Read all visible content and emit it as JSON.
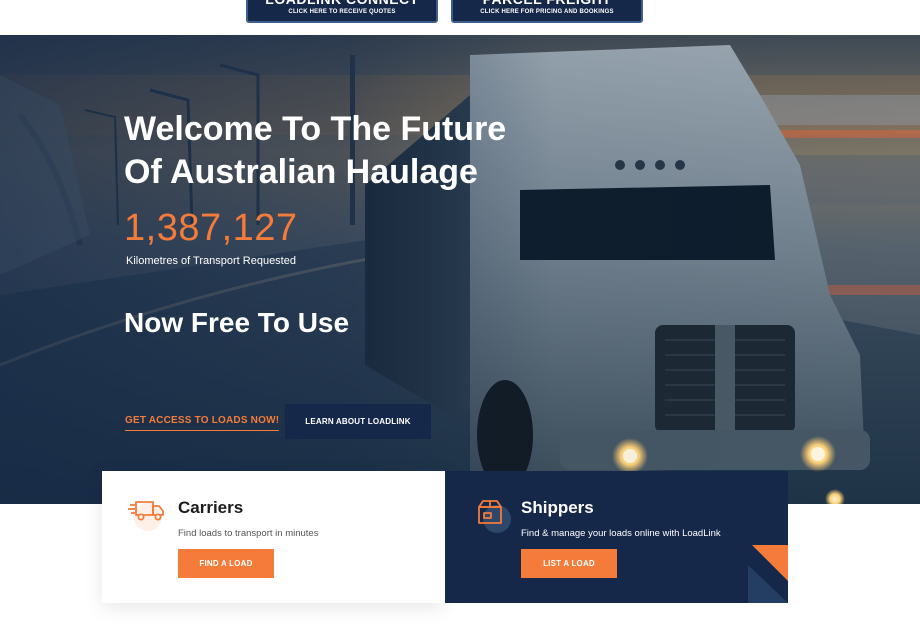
{
  "top_buttons": [
    {
      "title": "LOADLINK CONNECT",
      "subtitle": "CLICK HERE TO RECEIVE QUOTES"
    },
    {
      "title": "PARCEL FREIGHT",
      "subtitle": "CLICK HERE FOR PRICING AND BOOKINGS"
    }
  ],
  "hero": {
    "title_line1": "Welcome To The Future",
    "title_line2": "Of Australian Haulage",
    "counter": "1,387,127",
    "counter_label": "Kilometres of Transport Requested",
    "subheading": "Now Free To Use",
    "cta_link": "GET ACCESS TO LOADS NOW!",
    "cta_button": "LEARN ABOUT LOADLINK"
  },
  "cards": {
    "carriers": {
      "icon": "delivery-truck-icon",
      "title": "Carriers",
      "description": "Find loads to transport in minutes",
      "button": "FIND A LOAD"
    },
    "shippers": {
      "icon": "box-icon",
      "title": "Shippers",
      "description": "Find & manage your loads online with LoadLink",
      "button": "LIST A LOAD"
    }
  },
  "colors": {
    "navy": "#16284a",
    "orange": "#f47b3a",
    "white": "#ffffff"
  }
}
